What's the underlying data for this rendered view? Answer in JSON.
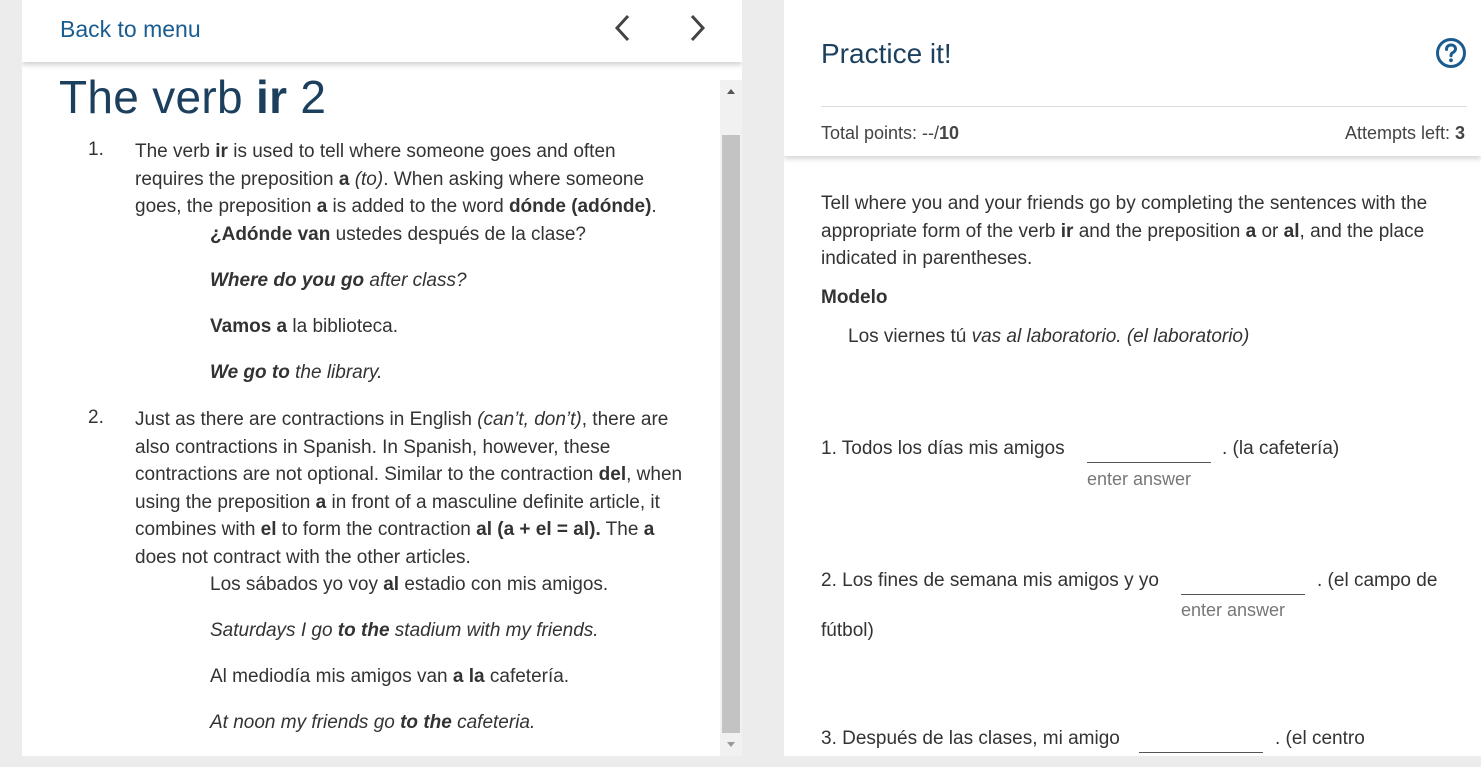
{
  "header": {
    "back_label": "Back to menu",
    "prev_icon": "chevron-left-icon",
    "next_icon": "chevron-right-icon"
  },
  "lesson": {
    "title_prefix": "The verb ",
    "title_bold": "ir",
    "title_suffix": " 2",
    "items": [
      {
        "number": "1.",
        "text_html": "The verb <b>ir</b> is used to tell where someone goes and often requires the preposition <b>a</b> <i>(to)</i>. When asking where someone goes, the preposition <b>a</b> is added to the word <b>dónde (adónde)</b>.",
        "examples": [
          "<b>¿Adónde van</b> ustedes después de la clase?",
          "<i><b>Where do you go</b> after class?</i>",
          "<b>Vamos a</b> la biblioteca.",
          "<i><b>We go to</b> the library.</i>"
        ]
      },
      {
        "number": "2.",
        "text_html": "Just as there are contractions in English <i>(can’t, don’t)</i>, there are also contractions in Spanish. In Spanish, however, these contractions are not optional. Similar to the contraction <b>del</b>, when using the preposition <b>a</b> in front of a masculine definite article, it combines with <b>el</b> to form the contraction <b>al (a + el = al).</b> The <b>a</b> does not contract with the other articles.",
        "examples": [
          "Los sábados yo voy <b>al</b> estadio con mis amigos.",
          "<i>Saturdays I go <b>to the</b> stadium with my friends.</i>",
          "Al mediodía mis amigos van <b>a la</b> cafetería.",
          "<i>At noon my friends go <b>to the</b> cafeteria.</i>"
        ]
      }
    ]
  },
  "practice": {
    "title": "Practice it!",
    "help_icon": "question-circle-icon",
    "points_label": "Total points: --/",
    "points_max": "10",
    "attempts_label": "Attempts left: ",
    "attempts_value": "3",
    "instructions_html": "Tell where you and your friends go by completing the sentences with the appropriate form of the verb <b>ir</b> and the preposition <b>a</b> or <b>al</b>, and the place indicated in parentheses.",
    "modelo_label": "Modelo",
    "modelo_html": "Los viernes tú <i>vas al laboratorio. (el laboratorio)</i>",
    "answer_placeholder": "enter answer",
    "questions": [
      {
        "pre": "1. Todos los días mis amigos",
        "post": ". (la cafetería)",
        "post2": "",
        "value": ""
      },
      {
        "pre": "2. Los fines de semana mis amigos y yo",
        "post": ". (el campo de",
        "post2": "fútbol)",
        "value": ""
      },
      {
        "pre": "3. Después de las clases, mi amigo",
        "post": ". (el centro",
        "post2": "",
        "value": ""
      }
    ]
  },
  "colors": {
    "accent": "#1a5c8f",
    "title": "#1c3f5e"
  }
}
